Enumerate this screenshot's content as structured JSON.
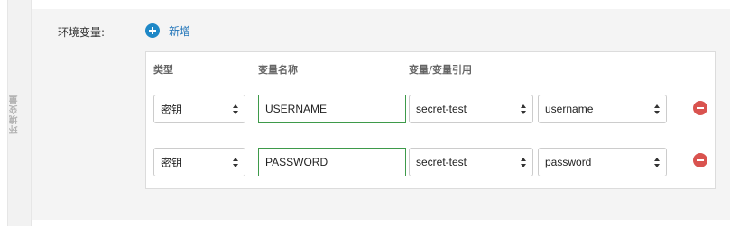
{
  "side_tab": {
    "label": "环境变量"
  },
  "section": {
    "label": "环境变量:",
    "add_label": "新增"
  },
  "table": {
    "headers": {
      "type": "类型",
      "name": "变量名称",
      "ref": "变量/变量引用"
    },
    "rows": [
      {
        "type": "密钥",
        "name": "USERNAME",
        "secret": "secret-test",
        "key": "username"
      },
      {
        "type": "密钥",
        "name": "PASSWORD",
        "secret": "secret-test",
        "key": "password"
      }
    ]
  },
  "icons": {
    "add": "plus-circle-icon",
    "remove": "minus-circle-icon"
  },
  "colors": {
    "accent": "#1e88c7",
    "input_border": "#3e9a4a",
    "remove": "#d9534f"
  }
}
